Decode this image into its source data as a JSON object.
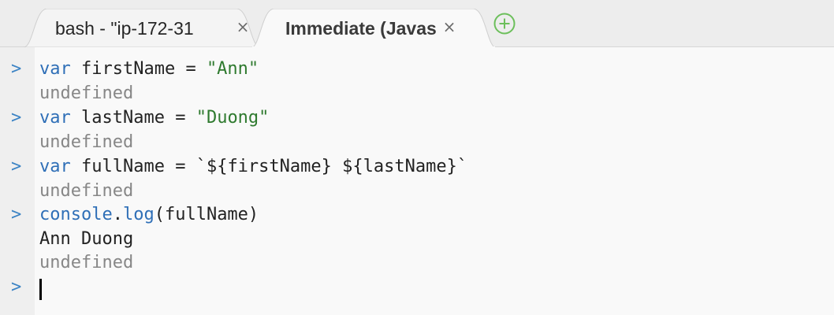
{
  "tabs": [
    {
      "label": "bash - \"ip-172-31",
      "close": "×",
      "active": false
    },
    {
      "label": "Immediate (Javas",
      "close": "×",
      "active": true
    }
  ],
  "add_tab_icon": "plus-circle-icon",
  "colors": {
    "prompt": "#3b83c4",
    "keyword": "#2f6fb7",
    "string": "#2f7a2f",
    "muted_output": "#878787",
    "add_icon": "#6cbf5b"
  },
  "console": {
    "prompt_glyph": ">",
    "lines": [
      {
        "type": "input",
        "keyword": "var",
        "rest": " firstName = ",
        "string": "\"Ann\""
      },
      {
        "type": "output",
        "text": "undefined"
      },
      {
        "type": "input",
        "keyword": "var",
        "rest": " lastName = ",
        "string": "\"Duong\""
      },
      {
        "type": "output",
        "text": "undefined"
      },
      {
        "type": "input",
        "keyword": "var",
        "rest": " fullName = ",
        "template": "`${firstName} ${lastName}`"
      },
      {
        "type": "output",
        "text": "undefined"
      },
      {
        "type": "input",
        "object": "console",
        "dot": ".",
        "method": "log",
        "args": "(fullName)"
      },
      {
        "type": "log",
        "text": "Ann Duong"
      },
      {
        "type": "output",
        "text": "undefined"
      }
    ]
  }
}
